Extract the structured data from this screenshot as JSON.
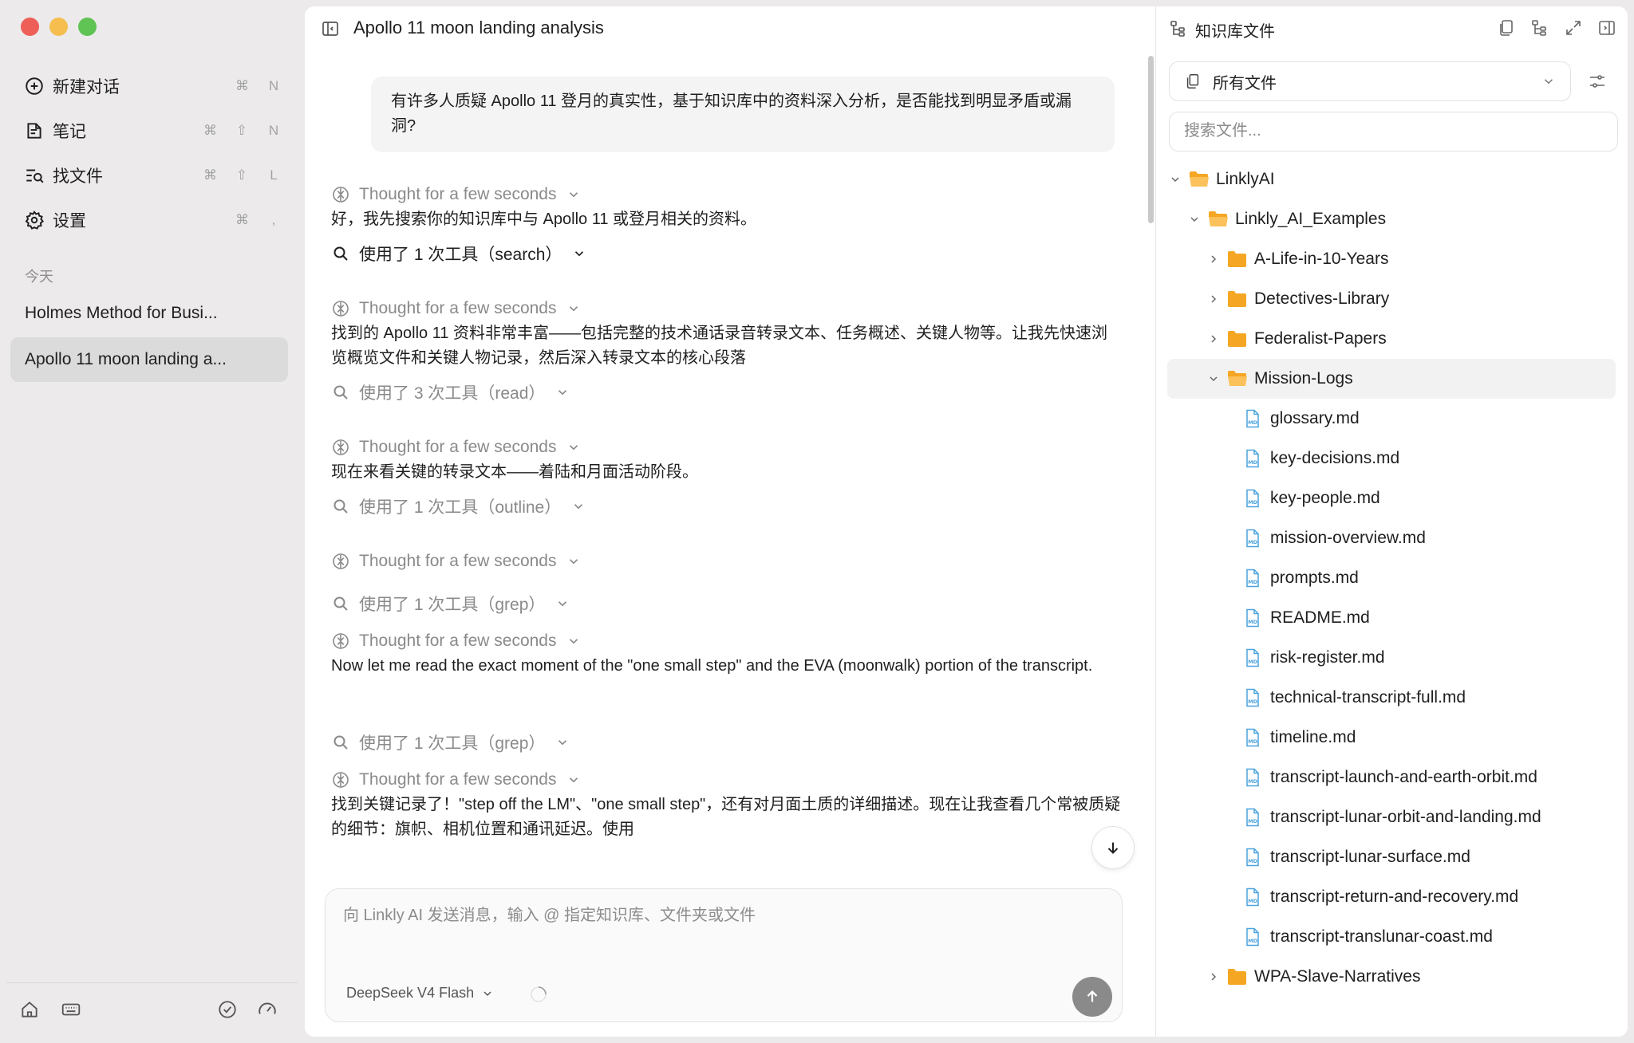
{
  "window": {
    "title": "Apollo 11 moon landing analysis"
  },
  "sidebar": {
    "menu": [
      {
        "label": "新建对话",
        "icon": "new-chat-icon",
        "keys": [
          "⌘",
          "N"
        ]
      },
      {
        "label": "笔记",
        "icon": "notes-icon",
        "keys": [
          "⌘",
          "⇧",
          "N"
        ]
      },
      {
        "label": "找文件",
        "icon": "find-file-icon",
        "keys": [
          "⌘",
          "⇧",
          "L"
        ]
      },
      {
        "label": "设置",
        "icon": "settings-icon",
        "keys": [
          "⌘",
          ","
        ]
      }
    ],
    "section_label": "今天",
    "conversations": [
      {
        "label": "Holmes Method for Busi..."
      },
      {
        "label": "Apollo 11 moon landing a..."
      }
    ]
  },
  "chat": {
    "user_message": "有许多人质疑 Apollo 11 登月的真实性，基于知识库中的资料深入分析，是否能找到明显矛盾或漏洞?",
    "thought_label": "Thought for a few seconds",
    "tool_calls": [
      "使用了 1 次工具（search）",
      "使用了 3 次工具（read）",
      "使用了 1 次工具（outline）",
      "使用了 1 次工具（grep）",
      "使用了 1 次工具（grep）"
    ],
    "paragraphs": [
      "好，我先搜索你的知识库中与 Apollo 11 或登月相关的资料。",
      "找到的 Apollo 11 资料非常丰富——包括完整的技术通话录音转录文本、任务概述、关键人物等。让我先快速浏览概览文件和关键人物记录，然后深入转录文本的核心段落",
      "现在来看关键的转录文本——着陆和月面活动阶段。",
      "Now let me read the exact moment of the \"one small step\" and the EVA (moonwalk) portion of the transcript.",
      "找到关键记录了！\"step off the LM\"、\"one small step\"，还有对月面土质的详细描述。现在让我查看几个常被质疑的细节：旗帜、相机位置和通讯延迟。使用"
    ]
  },
  "composer": {
    "placeholder": "向 Linkly AI 发送消息，输入 @ 指定知识库、文件夹或文件",
    "model": "DeepSeek V4 Flash"
  },
  "right_panel": {
    "title": "知识库文件",
    "filter_label": "所有文件",
    "search_placeholder": "搜索文件...",
    "tree": {
      "root": "LinklyAI",
      "examples": "Linkly_AI_Examples",
      "folders_before": [
        "A-Life-in-10-Years",
        "Detectives-Library",
        "Federalist-Papers"
      ],
      "open_folder": "Mission-Logs",
      "files": [
        "glossary.md",
        "key-decisions.md",
        "key-people.md",
        "mission-overview.md",
        "prompts.md",
        "README.md",
        "risk-register.md",
        "technical-transcript-full.md",
        "timeline.md",
        "transcript-launch-and-earth-orbit.md",
        "transcript-lunar-orbit-and-landing.md",
        "transcript-lunar-surface.md",
        "transcript-return-and-recovery.md",
        "transcript-translunar-coast.md"
      ],
      "folders_after": [
        "WPA-Slave-Narratives"
      ]
    }
  },
  "colors": {
    "traffic_red": "#ee5f57",
    "traffic_yellow": "#f5be4f",
    "traffic_green": "#5fc454",
    "folder": "#f5a623",
    "md_file": "#4aa3df",
    "send_button": "#8a8a8a"
  }
}
